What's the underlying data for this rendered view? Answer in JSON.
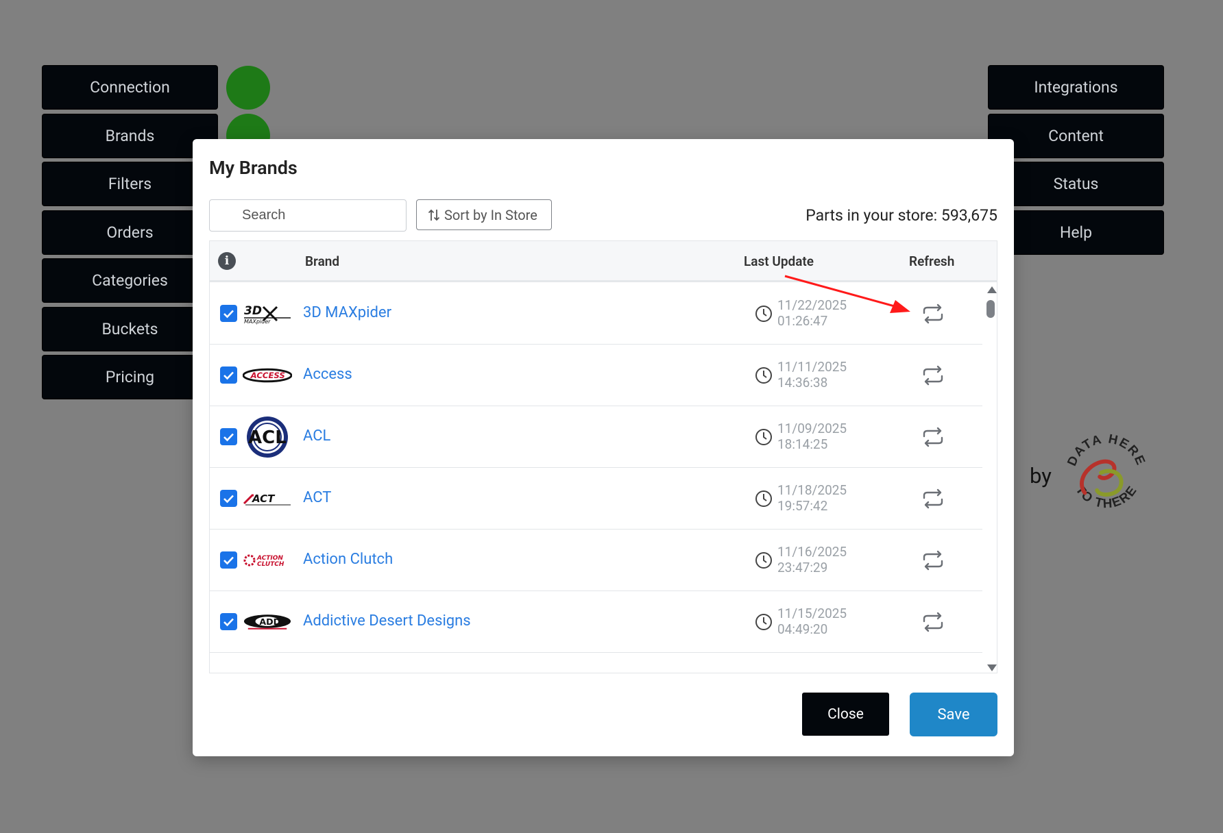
{
  "left_nav": [
    "Connection",
    "Brands",
    "Filters",
    "Orders",
    "Categories",
    "Buckets",
    "Pricing"
  ],
  "right_nav": [
    "Integrations",
    "Content",
    "Status",
    "Help"
  ],
  "status_dots": {
    "color": "#1e7a17"
  },
  "branding": {
    "by_label": "by",
    "logo_text_top": "DATA HERE",
    "logo_text_bottom": "TO THERE"
  },
  "modal": {
    "title": "My Brands",
    "search_placeholder": "Search",
    "sort_label": "Sort by In Store",
    "parts_label": "Parts in your store: 593,675",
    "columns": {
      "info": "i",
      "brand": "Brand",
      "last_update": "Last Update",
      "refresh": "Refresh"
    },
    "rows": [
      {
        "name": "3D MAXpider",
        "date": "11/22/2025",
        "time": "01:26:47",
        "checked": true,
        "logo_text": "3D MAXpider"
      },
      {
        "name": "Access",
        "date": "11/11/2025",
        "time": "14:36:38",
        "checked": true,
        "logo_text": "ACCESS"
      },
      {
        "name": "ACL",
        "date": "11/09/2025",
        "time": "18:14:25",
        "checked": true,
        "logo_text": "ACL"
      },
      {
        "name": "ACT",
        "date": "11/18/2025",
        "time": "19:57:42",
        "checked": true,
        "logo_text": "ACT"
      },
      {
        "name": "Action Clutch",
        "date": "11/16/2025",
        "time": "23:47:29",
        "checked": true,
        "logo_text": "ACTION CLUTCH"
      },
      {
        "name": "Addictive Desert Designs",
        "date": "11/15/2025",
        "time": "04:49:20",
        "checked": true,
        "logo_text": "ADD"
      }
    ],
    "close_label": "Close",
    "save_label": "Save"
  },
  "colors": {
    "link": "#2a7de1",
    "save": "#1f87c8",
    "dark": "#03070c",
    "arrow": "#ff1a1a"
  }
}
